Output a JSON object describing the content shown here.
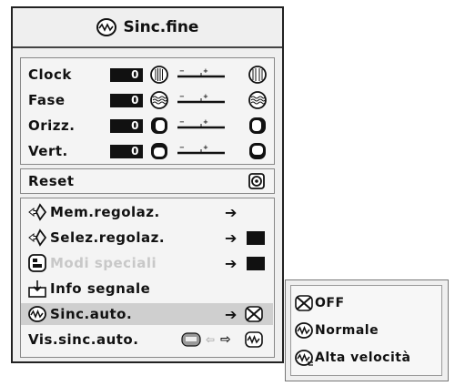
{
  "window": {
    "title": "Sinc.fine"
  },
  "adjust_rows": [
    {
      "label": "Clock",
      "value": "0",
      "icon_left": "clock-dense-icon",
      "icon_right": "clock-sparse-icon"
    },
    {
      "label": "Fase",
      "value": "0",
      "icon_left": "phase-wave-icon",
      "icon_right": "phase-wave-icon"
    },
    {
      "label": "Orizz.",
      "value": "0",
      "icon_left": "horizontal-left-icon",
      "icon_right": "horizontal-right-icon"
    },
    {
      "label": "Vert.",
      "value": "0",
      "icon_left": "vertical-down-icon",
      "icon_right": "vertical-up-icon"
    }
  ],
  "reset": {
    "label": "Reset",
    "icon": "reset-icon"
  },
  "menu_items": [
    {
      "label": "Mem.regolaz.",
      "icon": "diamond-arrow-icon",
      "enabled": true
    },
    {
      "label": "Selez.regolaz.",
      "icon": "diamond-arrow-icon",
      "enabled": true
    },
    {
      "label": "Modi speciali",
      "icon": "special-modes-icon",
      "enabled": false
    },
    {
      "label": "Info segnale",
      "icon": "signal-info-icon",
      "enabled": true
    },
    {
      "label": "Sinc.auto.",
      "icon": "auto-sync-icon",
      "enabled": true,
      "selected": true
    },
    {
      "label": "Vis.sinc.auto.",
      "icon": "auto-sync-icon",
      "enabled": true
    }
  ],
  "popup": {
    "options": [
      {
        "label": "OFF",
        "icon": "auto-sync-off-icon"
      },
      {
        "label": "Normale",
        "icon": "auto-sync-icon"
      },
      {
        "label": "Alta velocità",
        "icon": "auto-sync-fast-icon"
      }
    ]
  },
  "colors": {
    "window_bg": "#efefef",
    "highlight": "#cfcfcf",
    "disabled_text": "#c8c8c8"
  }
}
